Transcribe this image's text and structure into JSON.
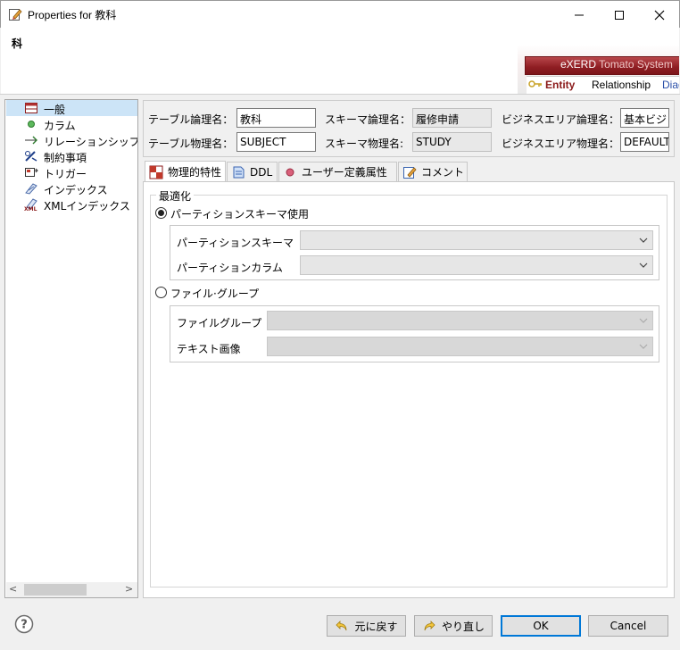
{
  "window": {
    "title": "Properties for 教科",
    "minimize_glyph": "—",
    "maximize_glyph": "☐",
    "close_glyph": "✕"
  },
  "header": {
    "title": "科",
    "banner": {
      "product": "eXERD",
      "product_suffix": "Tomato System",
      "tabs": [
        "Entity",
        "Relationship",
        "Diag"
      ]
    }
  },
  "tree": {
    "items": [
      {
        "label": "一般",
        "icon": "table-icon",
        "selected": true
      },
      {
        "label": "カラム",
        "icon": "column-dot-icon"
      },
      {
        "label": "リレーションシップ",
        "icon": "relationship-arrow-icon"
      },
      {
        "label": "制約事項",
        "icon": "constraint-icon"
      },
      {
        "label": "トリガー",
        "icon": "trigger-icon"
      },
      {
        "label": "インデックス",
        "icon": "index-icon"
      },
      {
        "label": "XMLインデックス",
        "icon": "xml-index-icon"
      }
    ],
    "scroll_left": "<",
    "scroll_right": ">"
  },
  "fields": {
    "table_logical_label": "テーブル論理名：",
    "table_logical_value": "教科",
    "schema_logical_label": "スキーマ論理名：",
    "schema_logical_value": "履修申請",
    "business_logical_label": "ビジネスエリア論理名：",
    "business_logical_value": "基本ビジ",
    "table_physical_label": "テーブル物理名：",
    "table_physical_value": "SUBJECT",
    "schema_physical_label": "スキーマ物理名:",
    "schema_physical_value": "STUDY",
    "business_physical_label": "ビジネスエリア物理名：",
    "business_physical_value": "DEFAULT"
  },
  "tabs": [
    {
      "label": "物理的特性",
      "icon": "physical-props-icon",
      "active": true
    },
    {
      "label": "DDL",
      "icon": "ddl-icon"
    },
    {
      "label": "ユーザー定義属性",
      "icon": "user-attr-icon"
    },
    {
      "label": "コメント",
      "icon": "comment-icon"
    }
  ],
  "optimize": {
    "group_label": "最適化",
    "partition_radio": {
      "label": "パーティションスキーマ使用",
      "checked": true
    },
    "partition_schema_label": "パーティションスキーマ",
    "partition_column_label": "パーティションカラム",
    "filegroup_radio": {
      "label": "ファイル·グループ",
      "checked": false
    },
    "filegroup_label": "ファイルグループ",
    "text_image_label": "テキスト画像"
  },
  "buttons": {
    "undo": "元に戻す",
    "redo": "やり直し",
    "ok": "OK",
    "cancel": "Cancel",
    "help": "?"
  }
}
